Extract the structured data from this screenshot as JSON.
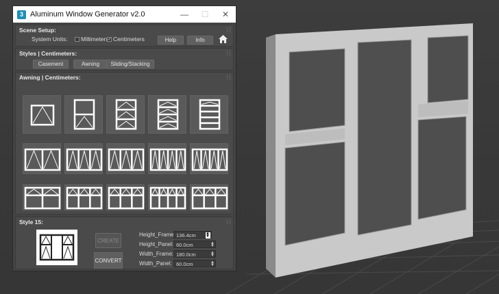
{
  "window": {
    "title": "Aluminum Window Generator v2.0",
    "icon_text": "3"
  },
  "scene_setup": {
    "header": "Scene Setup:",
    "system_units_label": "System Units:",
    "millimeters_label": "Millimeters",
    "millimeters_checked": false,
    "centimeters_label": "Centimeters",
    "centimeters_checked": true,
    "help_label": "Help",
    "info_label": "Info"
  },
  "styles": {
    "header": "Styles | Centimeters:",
    "buttons": [
      "Casement",
      "Awning",
      "Sliding/Stacking"
    ]
  },
  "awning": {
    "header": "Awning | Centimeters:"
  },
  "style15": {
    "header": "Style 15:",
    "create_label": "CREATE",
    "convert_label": "CONVERT",
    "fields": [
      {
        "label": "Height_Frame:",
        "value": "136.4cm"
      },
      {
        "label": "Height_Panel:",
        "value": "60.0cm"
      },
      {
        "label": "Width_Frame:",
        "value": "180.0cm"
      },
      {
        "label": "Width_Panel:",
        "value": "60.0cm"
      }
    ]
  },
  "icons": [
    "app-icon",
    "minimize-icon",
    "maximize-icon",
    "close-icon",
    "home-icon",
    "resize-cursor-icon"
  ]
}
